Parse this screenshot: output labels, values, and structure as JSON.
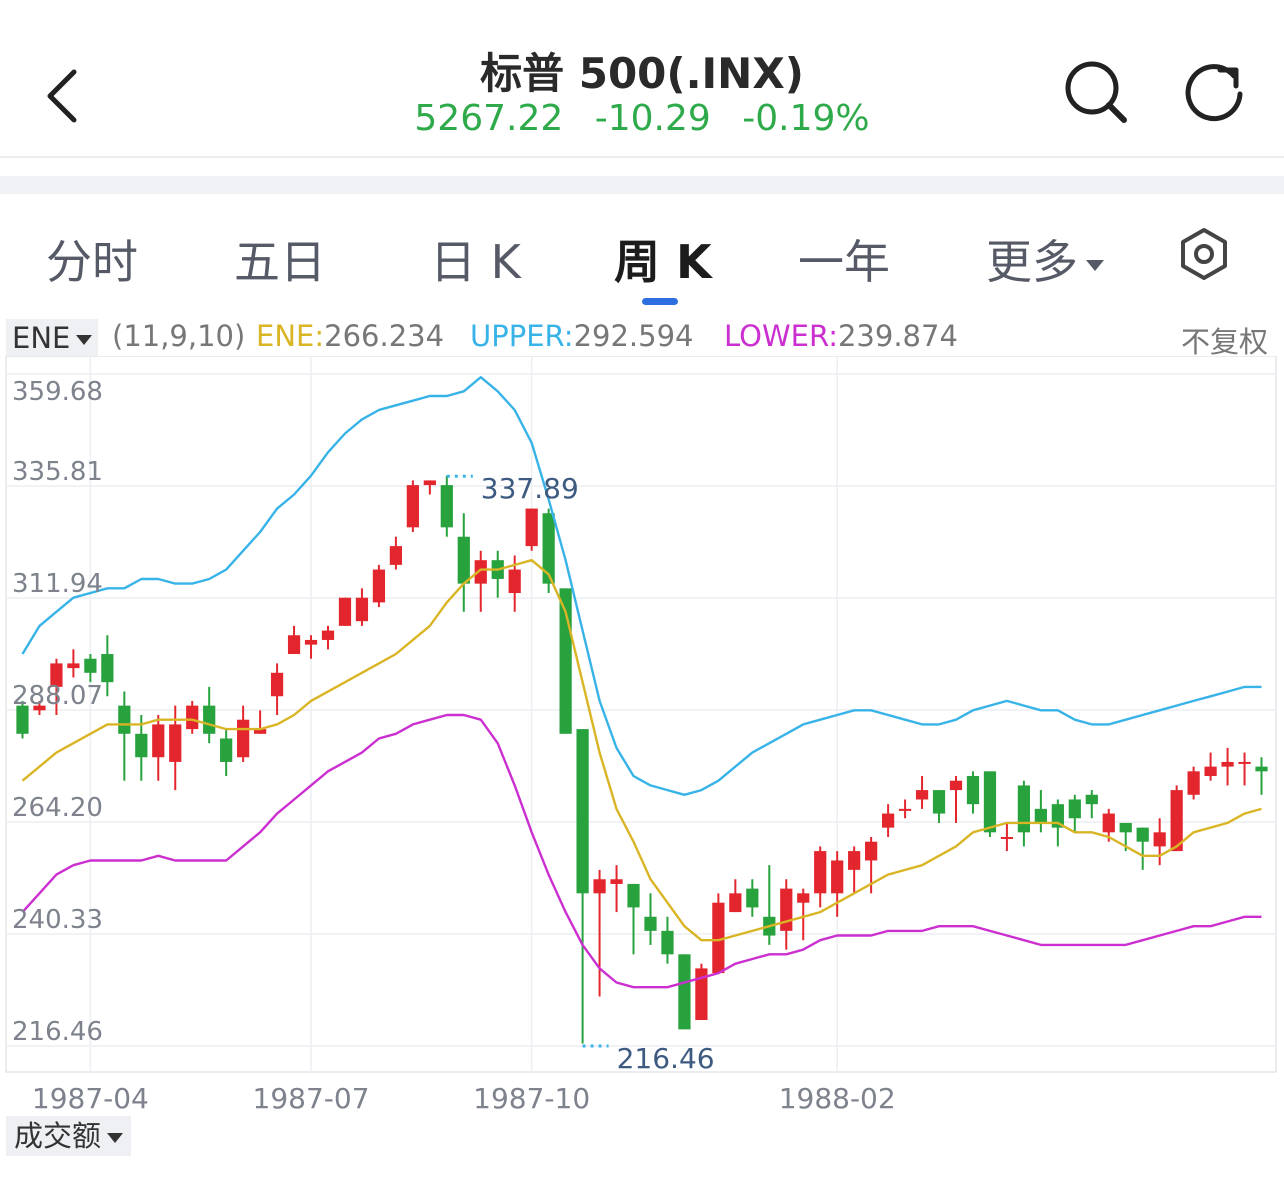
{
  "header": {
    "title": "标普 500(.INX)",
    "price": "5267.22",
    "change": "-10.29",
    "change_pct": "-0.19%"
  },
  "tabs": [
    {
      "label": "分时"
    },
    {
      "label": "五日"
    },
    {
      "label": "日 K"
    },
    {
      "label": "周 K",
      "active": true
    },
    {
      "label": "一年"
    },
    {
      "label": "更多"
    }
  ],
  "indicator": {
    "name": "ENE",
    "params": "(11,9,10)",
    "ene_label": "ENE:",
    "ene_value": "266.234",
    "upper_label": "UPPER:",
    "upper_value": "292.594",
    "lower_label": "LOWER:",
    "lower_value": "239.874",
    "adjust": "不复权"
  },
  "volume_selector": "成交额",
  "colors": {
    "up": "#e3262d",
    "down": "#27a23d",
    "ene": "#d9b526",
    "upper": "#38b3e8",
    "lower": "#cc2fd0",
    "quote": "#2eaa4a",
    "tab_indicator": "#2d6fe0"
  },
  "icons": {
    "back": "chevron-left-icon",
    "search": "search-icon",
    "refresh": "refresh-icon",
    "settings": "settings-hexagon-icon"
  },
  "chart_data": {
    "type": "candlestick",
    "y_ticks": [
      "359.68",
      "335.81",
      "311.94",
      "288.07",
      "264.20",
      "240.33",
      "216.46"
    ],
    "y_range": [
      216.46,
      359.68
    ],
    "x_ticks": [
      {
        "label": "1987-04",
        "index": 4
      },
      {
        "label": "1987-07",
        "index": 17
      },
      {
        "label": "1987-10",
        "index": 30
      },
      {
        "label": "1988-02",
        "index": 48
      }
    ],
    "max_label": "337.89",
    "max_index": 25,
    "min_label": "216.46",
    "min_index": 33,
    "candles": [
      [
        289,
        283,
        290,
        282
      ],
      [
        288,
        289,
        290,
        287
      ],
      [
        293,
        298,
        299,
        287
      ],
      [
        297,
        298,
        301,
        295
      ],
      [
        299,
        296,
        300,
        294
      ],
      [
        300,
        294,
        304,
        291
      ],
      [
        289,
        283,
        292,
        273
      ],
      [
        283,
        278,
        287,
        273
      ],
      [
        278,
        285,
        287,
        273
      ],
      [
        277,
        285,
        289,
        271
      ],
      [
        284,
        289,
        290,
        283
      ],
      [
        289,
        283,
        293,
        281
      ],
      [
        282,
        277,
        284,
        274
      ],
      [
        278,
        286,
        289,
        277
      ],
      [
        283,
        284,
        288,
        283
      ],
      [
        291,
        296,
        298,
        287
      ],
      [
        300,
        304,
        306,
        301
      ],
      [
        302,
        303,
        304,
        299
      ],
      [
        303,
        305,
        306,
        301
      ],
      [
        306,
        312,
        312,
        306
      ],
      [
        307,
        312,
        314,
        306
      ],
      [
        311,
        318,
        319,
        310
      ],
      [
        319,
        323,
        325,
        318
      ],
      [
        327,
        336,
        337,
        326
      ],
      [
        336,
        337,
        337,
        334
      ],
      [
        336,
        327,
        338,
        325
      ],
      [
        325,
        315,
        330,
        309
      ],
      [
        315,
        320,
        322,
        309
      ],
      [
        320,
        316,
        322,
        312
      ],
      [
        313,
        318,
        321,
        309
      ],
      [
        323,
        331,
        331,
        322
      ],
      [
        330,
        315,
        331,
        313
      ],
      [
        314,
        283,
        314,
        283
      ],
      [
        284,
        249,
        284,
        217
      ],
      [
        249,
        252,
        254,
        227
      ],
      [
        251,
        252,
        255,
        245
      ],
      [
        251,
        246,
        251,
        236
      ],
      [
        244,
        241,
        249,
        238
      ],
      [
        241,
        236,
        244,
        234
      ],
      [
        236,
        220,
        236,
        221
      ],
      [
        222,
        233,
        234,
        222
      ],
      [
        232,
        247,
        249,
        232
      ],
      [
        245,
        249,
        252,
        245
      ],
      [
        250,
        246,
        252,
        244
      ],
      [
        244,
        240,
        255,
        238
      ],
      [
        241,
        250,
        252,
        237
      ],
      [
        247,
        249,
        250,
        239
      ],
      [
        249,
        258,
        259,
        246
      ],
      [
        249,
        256,
        258,
        244
      ],
      [
        254,
        258,
        259,
        249
      ],
      [
        256,
        260,
        261,
        249
      ],
      [
        263,
        266,
        268,
        261
      ],
      [
        267,
        267,
        269,
        265
      ],
      [
        269,
        271,
        274,
        267
      ],
      [
        271,
        266,
        271,
        264
      ],
      [
        271,
        273,
        274,
        264
      ],
      [
        274,
        268,
        275,
        266
      ],
      [
        275,
        262,
        275,
        261
      ],
      [
        261,
        261,
        264,
        258
      ],
      [
        272,
        262,
        273,
        259
      ],
      [
        267,
        264,
        271,
        262
      ],
      [
        268,
        263,
        269,
        259
      ],
      [
        269,
        265,
        270,
        262
      ],
      [
        270,
        268,
        271,
        265
      ],
      [
        262,
        266,
        267,
        260
      ],
      [
        264,
        262,
        264,
        258
      ],
      [
        263,
        260,
        263,
        254
      ],
      [
        259,
        262,
        265,
        255
      ],
      [
        258,
        271,
        272,
        258
      ],
      [
        270,
        275,
        276,
        269
      ],
      [
        274,
        276,
        279,
        273
      ],
      [
        276,
        277,
        280,
        272
      ],
      [
        277,
        277,
        279,
        272
      ],
      [
        276,
        275,
        278,
        270
      ]
    ],
    "ene": [
      273,
      276,
      279,
      281,
      283,
      285,
      285,
      285,
      286,
      286,
      286,
      285,
      284,
      284,
      284,
      285,
      287,
      290,
      292,
      294,
      296,
      298,
      300,
      303,
      306,
      311,
      315,
      318,
      318,
      319,
      320,
      317,
      309,
      294,
      279,
      267,
      260,
      252,
      247,
      242,
      239,
      239,
      240,
      241,
      242,
      243,
      244,
      245,
      247,
      249,
      251,
      253,
      254,
      255,
      257,
      259,
      262,
      263,
      264,
      264,
      264,
      264,
      262,
      262,
      261,
      259,
      257,
      257,
      259,
      262,
      263,
      264,
      266,
      267
    ],
    "upper": [
      300,
      306,
      309,
      312,
      313,
      314,
      314,
      316,
      316,
      315,
      315,
      316,
      318,
      322,
      326,
      331,
      334,
      338,
      343,
      347,
      350,
      352,
      353,
      354,
      355,
      355,
      356,
      359,
      356,
      352,
      345,
      333,
      320,
      305,
      290,
      280,
      274,
      272,
      271,
      270,
      271,
      273,
      276,
      279,
      281,
      283,
      285,
      286,
      287,
      288,
      288,
      287,
      286,
      285,
      285,
      286,
      288,
      289,
      290,
      289,
      288,
      288,
      286,
      285,
      285,
      286,
      287,
      288,
      289,
      290,
      291,
      292,
      293,
      293
    ],
    "lower": [
      245,
      249,
      253,
      255,
      256,
      256,
      256,
      256,
      257,
      256,
      256,
      256,
      256,
      259,
      262,
      266,
      269,
      272,
      275,
      277,
      279,
      282,
      283,
      285,
      286,
      287,
      287,
      286,
      281,
      272,
      262,
      253,
      245,
      238,
      233,
      230,
      229,
      229,
      229,
      230,
      231,
      232,
      234,
      235,
      236,
      236,
      237,
      239,
      240,
      240,
      240,
      241,
      241,
      241,
      242,
      242,
      242,
      241,
      240,
      239,
      238,
      238,
      238,
      238,
      238,
      238,
      239,
      240,
      241,
      242,
      242,
      243,
      244,
      244
    ]
  }
}
